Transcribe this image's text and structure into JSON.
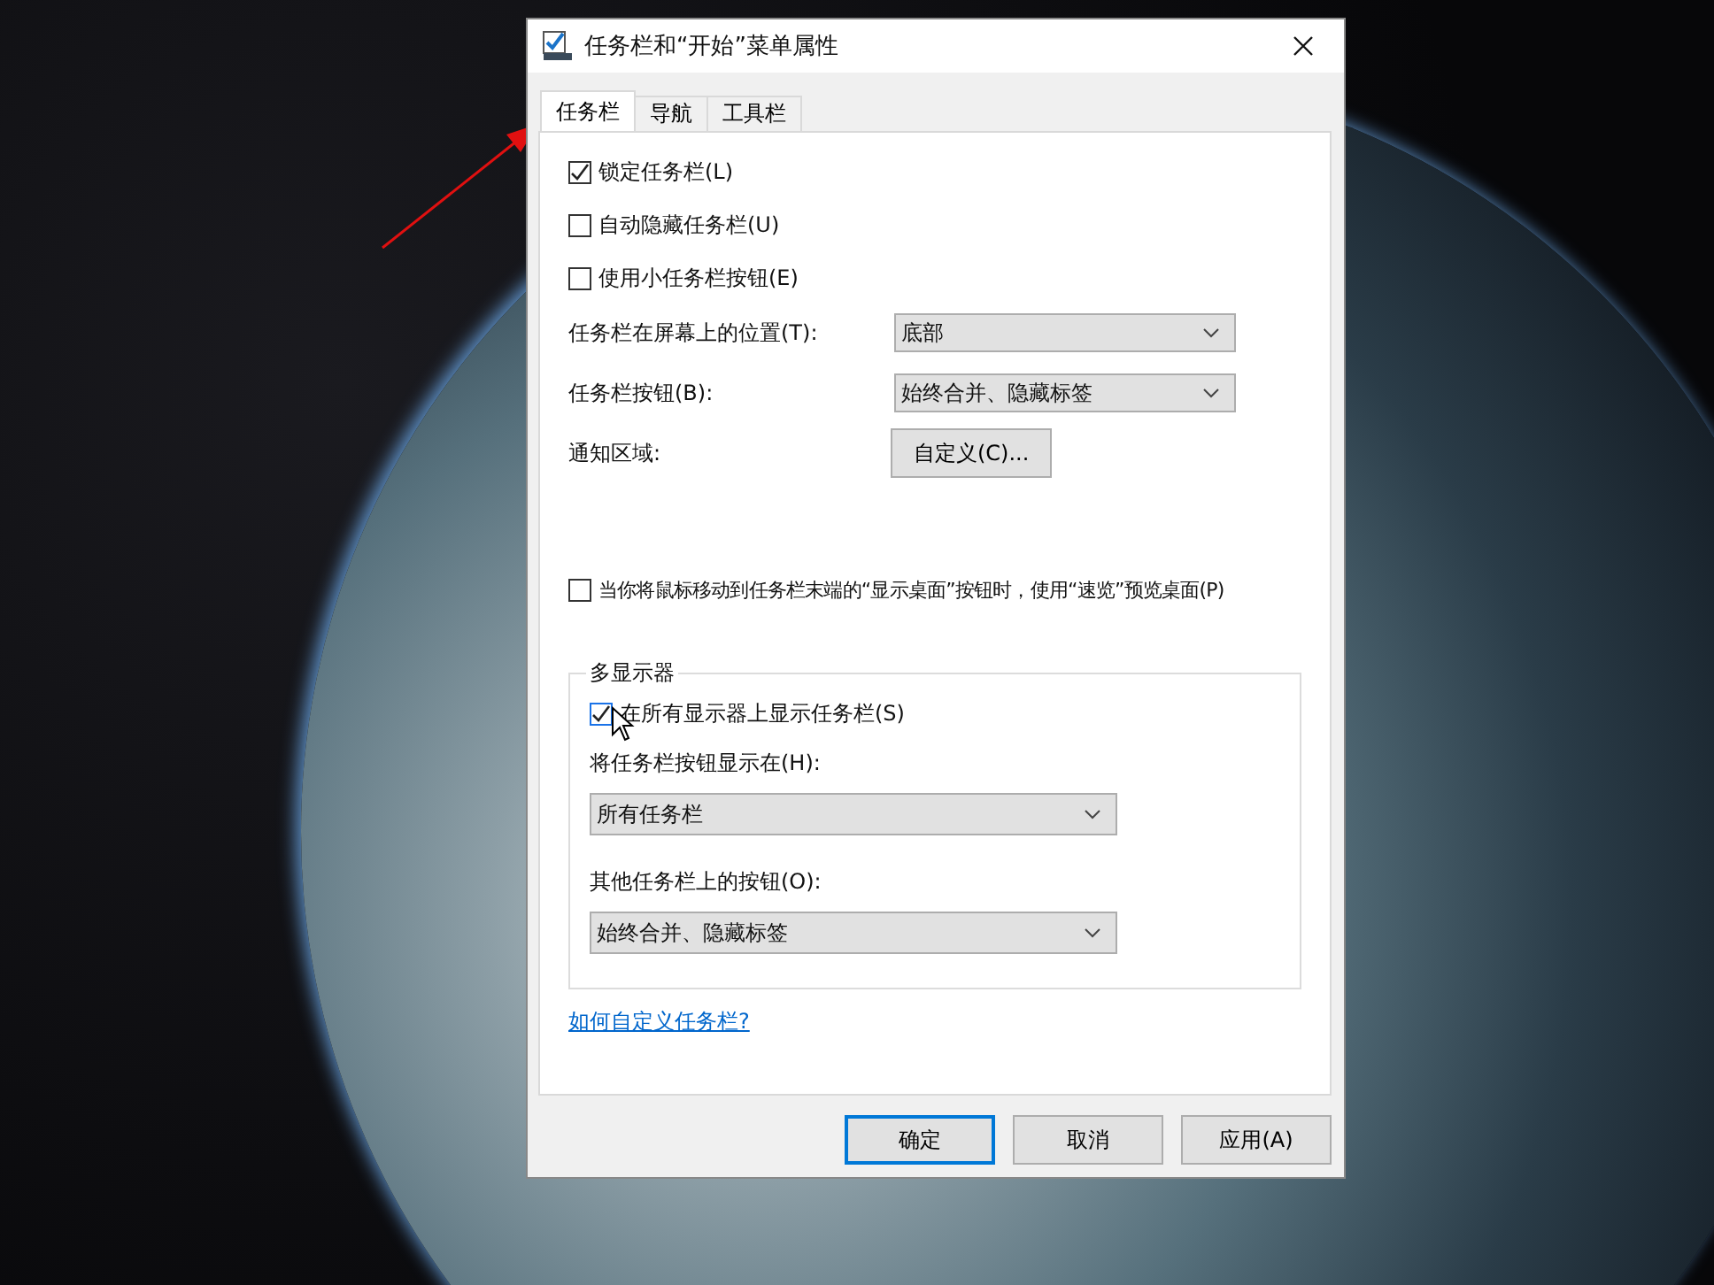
{
  "window": {
    "title": "任务栏和“开始”菜单属性"
  },
  "tabs": [
    {
      "label": "任务栏",
      "selected": true
    },
    {
      "label": "导航",
      "selected": false
    },
    {
      "label": "工具栏",
      "selected": false
    }
  ],
  "options": [
    {
      "label": "锁定任务栏(L)",
      "checked": true
    },
    {
      "label": "自动隐藏任务栏(U)",
      "checked": false
    },
    {
      "label": "使用小任务栏按钮(E)",
      "checked": false
    }
  ],
  "settings": [
    {
      "kind": "dropdown",
      "label": "任务栏在屏幕上的位置(T):",
      "value": "底部"
    },
    {
      "kind": "dropdown",
      "label": "任务栏按钮(B):",
      "value": "始终合并、隐藏标签"
    },
    {
      "kind": "button",
      "label": "通知区域:",
      "value": "自定义(C)..."
    }
  ],
  "peek_option": {
    "label": "当你将鼠标移动到任务栏末端的“显示桌面”按钮时，使用“速览”预览桌面(P)",
    "checked": false
  },
  "multi_display": {
    "title": "多显示器",
    "show_on_all": {
      "label": "在所有显示器上显示任务栏(S)",
      "checked": true
    },
    "fields": [
      {
        "label": "将任务栏按钮显示在(H):",
        "value": "所有任务栏"
      },
      {
        "label": "其他任务栏上的按钮(O):",
        "value": "始终合并、隐藏标签"
      }
    ]
  },
  "help_link": "如何自定义任务栏?",
  "buttons": [
    {
      "label": "确定",
      "default": true
    },
    {
      "label": "取消",
      "default": false
    },
    {
      "label": "应用(A)",
      "default": false
    }
  ]
}
